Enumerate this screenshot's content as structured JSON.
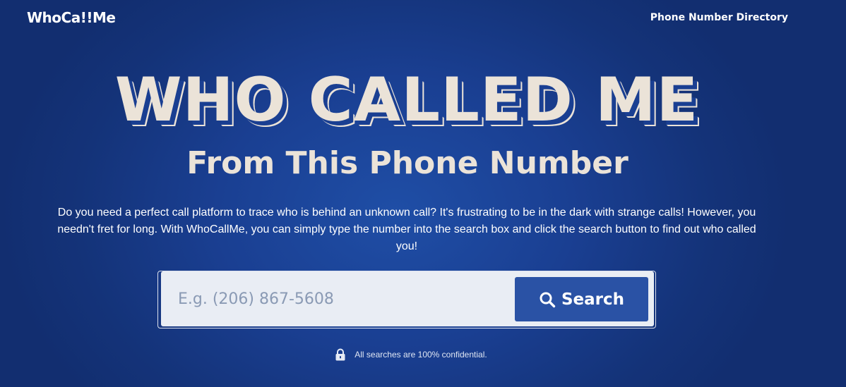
{
  "header": {
    "logo": "WhoCa!!Me",
    "nav_link": "Phone Number Directory"
  },
  "hero": {
    "title": "WHO CALLED ME",
    "subtitle": "From This Phone Number",
    "description": "Do you need a perfect call platform to trace who is behind an unknown call? It's frustrating to be in the dark with strange calls! However, you needn't fret for long. With WhoCallMe, you can simply type the number into the search box and click the search button to find out who called you!"
  },
  "search": {
    "value": "",
    "placeholder": "E.g. (206) 867-5608",
    "button_label": "Search",
    "button_icon": "search-icon"
  },
  "footer_note": {
    "icon": "lock-icon",
    "text": "All searches are 100% confidential."
  },
  "colors": {
    "background": "#1a3f92",
    "title": "#ebe3d8",
    "button": "#2a52a5",
    "input_bg": "#e9edf4"
  }
}
